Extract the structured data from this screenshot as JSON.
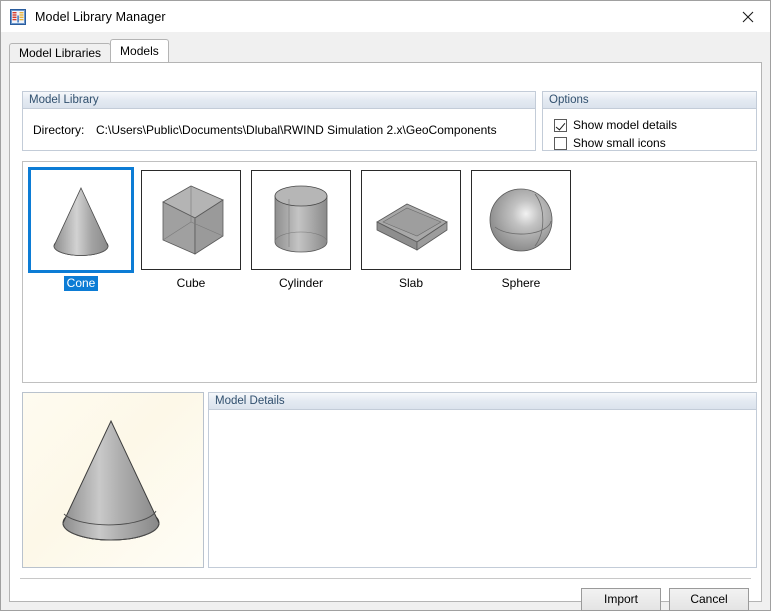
{
  "window": {
    "title": "Model Library Manager",
    "icon": "library-table-icon",
    "close_label": "×"
  },
  "tabs": [
    {
      "label": "Model Libraries",
      "active": false
    },
    {
      "label": "Models",
      "active": true
    }
  ],
  "model_library": {
    "header": "Model Library",
    "directory_label": "Directory:",
    "directory_value": "C:\\Users\\Public\\Documents\\Dlubal\\RWIND Simulation 2.x\\GeoComponents"
  },
  "options": {
    "header": "Options",
    "items": [
      {
        "label": "Show model details",
        "checked": true
      },
      {
        "label": "Show small icons",
        "checked": false
      }
    ]
  },
  "models": [
    {
      "label": "Cone",
      "shape": "cone",
      "selected": true
    },
    {
      "label": "Cube",
      "shape": "cube",
      "selected": false
    },
    {
      "label": "Cylinder",
      "shape": "cylinder",
      "selected": false
    },
    {
      "label": "Slab",
      "shape": "slab",
      "selected": false
    },
    {
      "label": "Sphere",
      "shape": "sphere",
      "selected": false
    }
  ],
  "preview": {
    "shape": "cone",
    "background_color": "#fdf9ec"
  },
  "details": {
    "header": "Model Details",
    "content": ""
  },
  "footer": {
    "import_label": "Import",
    "cancel_label": "Cancel"
  },
  "colors": {
    "selection_blue": "#0c7cd5",
    "group_header_text": "#31506e",
    "shape_fill": "#9a9a9a"
  }
}
